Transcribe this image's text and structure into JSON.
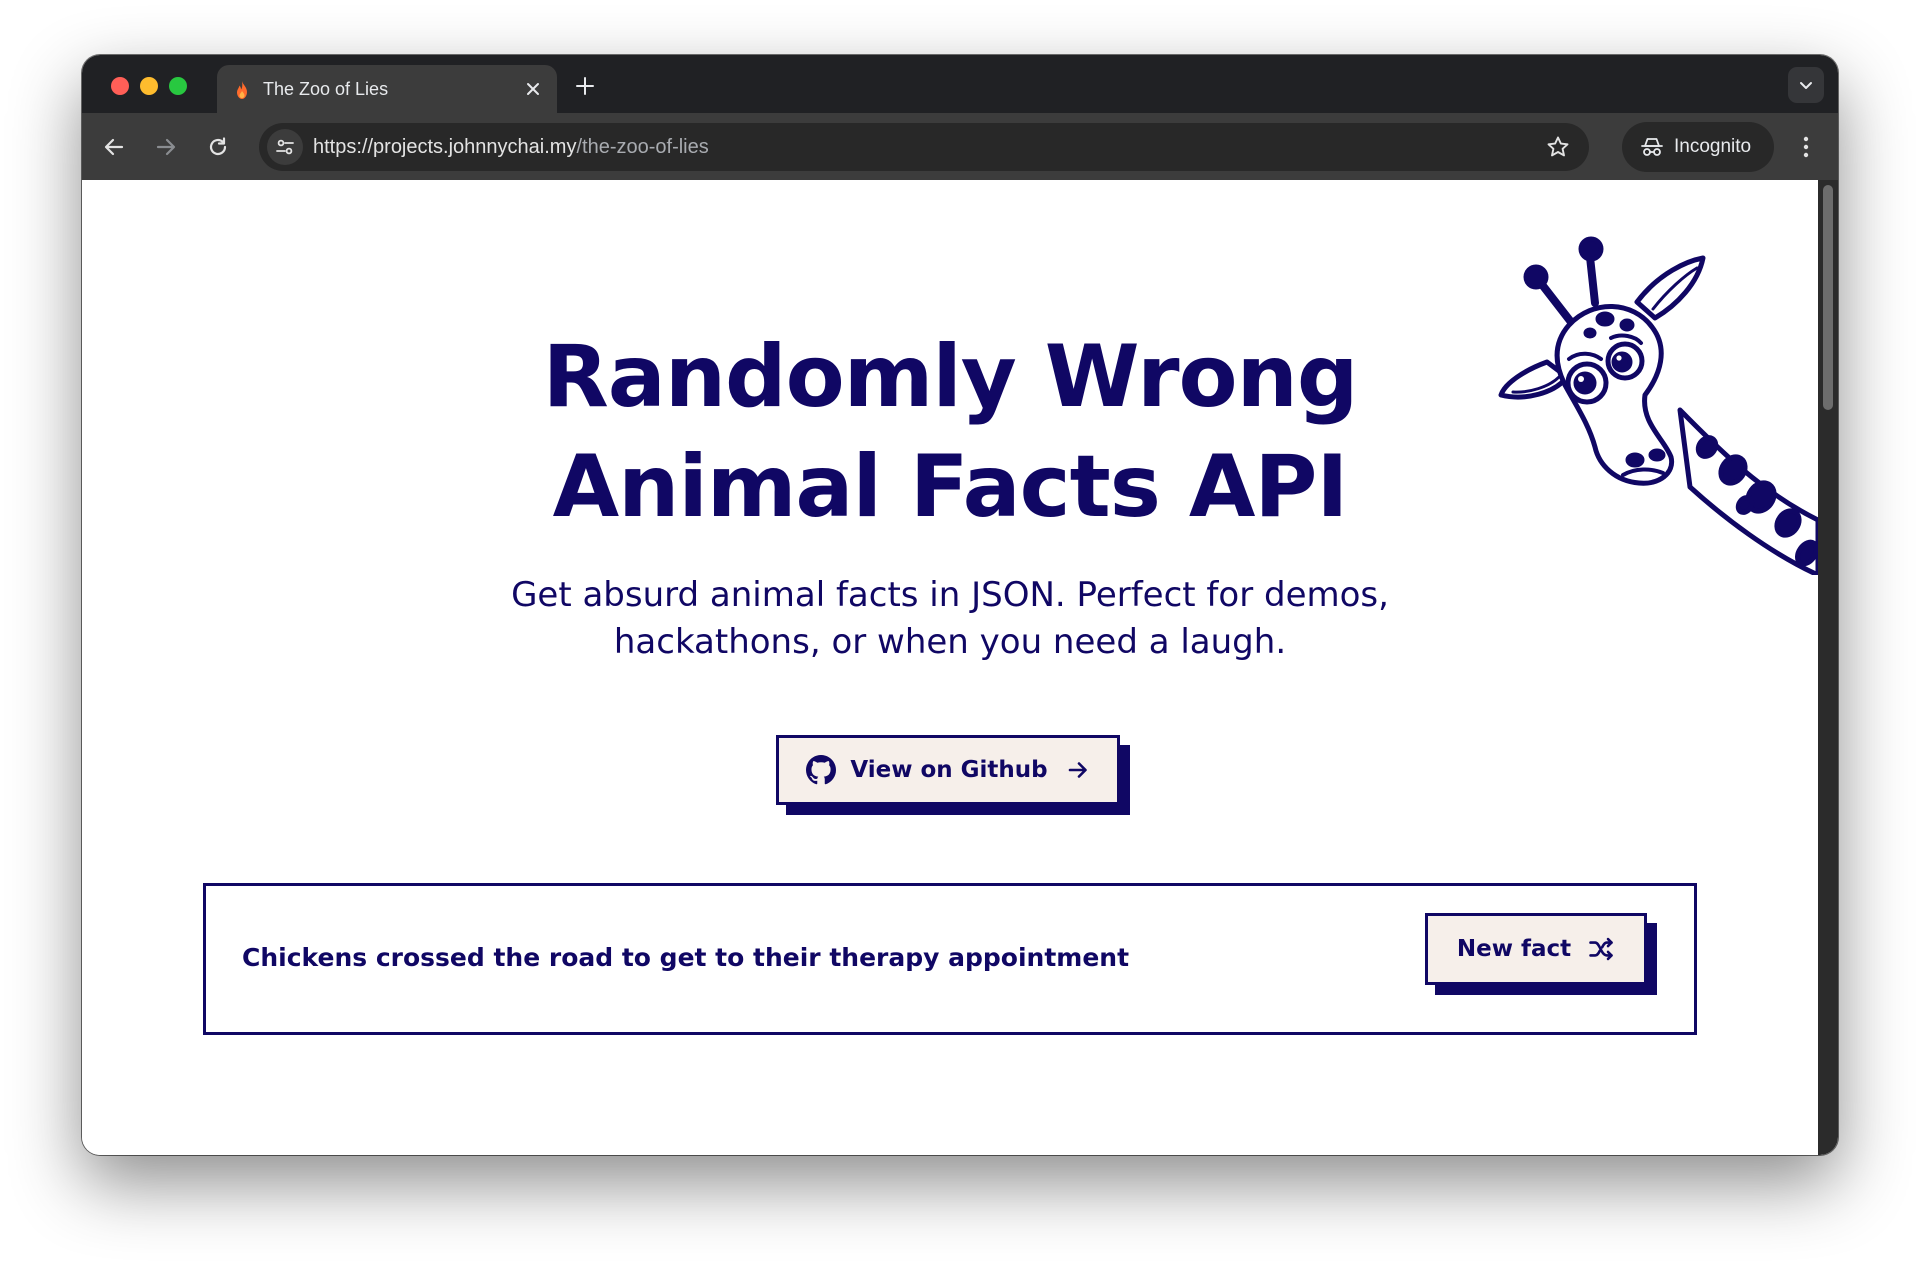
{
  "browser": {
    "tab_title": "The Zoo of Lies",
    "url_host": "https://projects.johnnychai.my",
    "url_path": "/the-zoo-of-lies",
    "profile_label": "Incognito",
    "icons": {
      "favicon": "fire-icon",
      "tab_close": "close-icon",
      "new_tab": "plus-icon",
      "tab_search": "chevron-down-icon",
      "back": "arrow-left-icon",
      "forward": "arrow-right-icon",
      "reload": "reload-icon",
      "site_info": "tune-icon",
      "bookmark": "star-icon",
      "incognito": "incognito-icon",
      "menu": "kebab-menu-icon"
    }
  },
  "page": {
    "hero_title_line1": "Randomly Wrong",
    "hero_title_line2": "Animal Facts API",
    "subtitle_line1": "Get absurd animal facts in JSON. Perfect for demos,",
    "subtitle_line2": "hackathons, or when you need a laugh.",
    "github_button_label": "View on Github",
    "fact_text": "Chickens crossed the road to get to their therapy appointment",
    "new_fact_button_label": "New fact",
    "illustration": "giraffe-illustration",
    "colors": {
      "ink": "#100764",
      "button_fill": "#f6efea",
      "background": "#ffffff"
    }
  }
}
